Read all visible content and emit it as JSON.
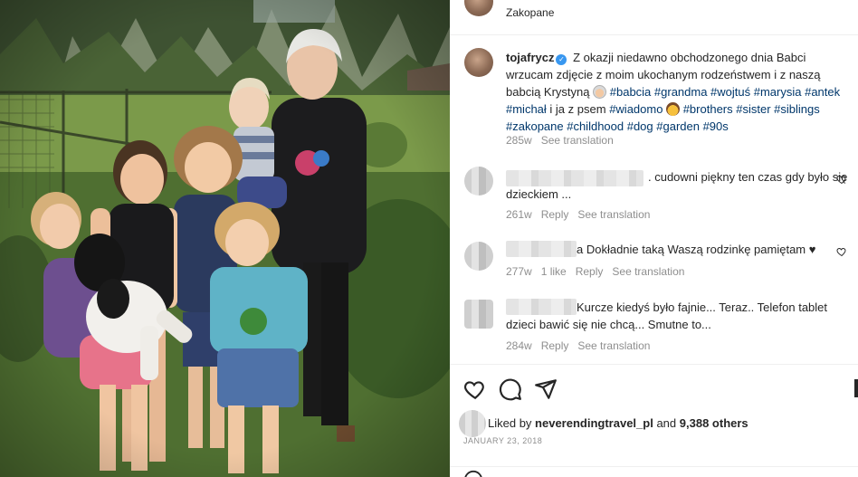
{
  "header": {
    "location": "Zakopane"
  },
  "post": {
    "username": "tojafrycz",
    "caption_text_1": "Z okazji niedawno obchodzonego dnia Babci wrzucam zdjęcie z moim ukochanym rodzeństwem i z naszą babcią Krystyną",
    "hashtags_1": "#babcia #grandma #wojtuś #marysia #antek #michał",
    "caption_text_2": "i ja z psem",
    "hashtag_wiadomo": "#wiadomo",
    "hashtags_2": "#brothers #sister #siblings #zakopane #childhood #dog #garden #90s",
    "time": "285w",
    "see_translation": "See translation"
  },
  "comments": [
    {
      "text": ". cudowni piękny ten czas gdy było się dzieckiem ...",
      "time": "261w",
      "reply": "Reply",
      "see_translation": "See translation"
    },
    {
      "text": "a Dokładnie taką Waszą rodzinkę pamiętam ♥",
      "time": "277w",
      "likes": "1 like",
      "reply": "Reply",
      "see_translation": "See translation"
    },
    {
      "text": "Kurcze kiedyś było fajnie... Teraz.. Telefon tablet dzieci bawić się nie chcą... Smutne to...",
      "time": "284w",
      "reply": "Reply",
      "see_translation": "See translation"
    }
  ],
  "footer": {
    "liked_by_prefix": "Liked by",
    "liked_by_user": "neverendingtravel_pl",
    "liked_by_and": "and",
    "others": "9,388 others",
    "date": "JANUARY 23, 2018"
  },
  "icons": [
    "heart-icon",
    "comment-icon",
    "share-icon",
    "verified-badge-icon",
    "emoji-grandma-icon",
    "emoji-woman-icon"
  ],
  "colors": {
    "hashtag": "#00376b",
    "meta_gray": "#8e8e8e",
    "verified_blue": "#3897f0",
    "text": "#262626"
  }
}
